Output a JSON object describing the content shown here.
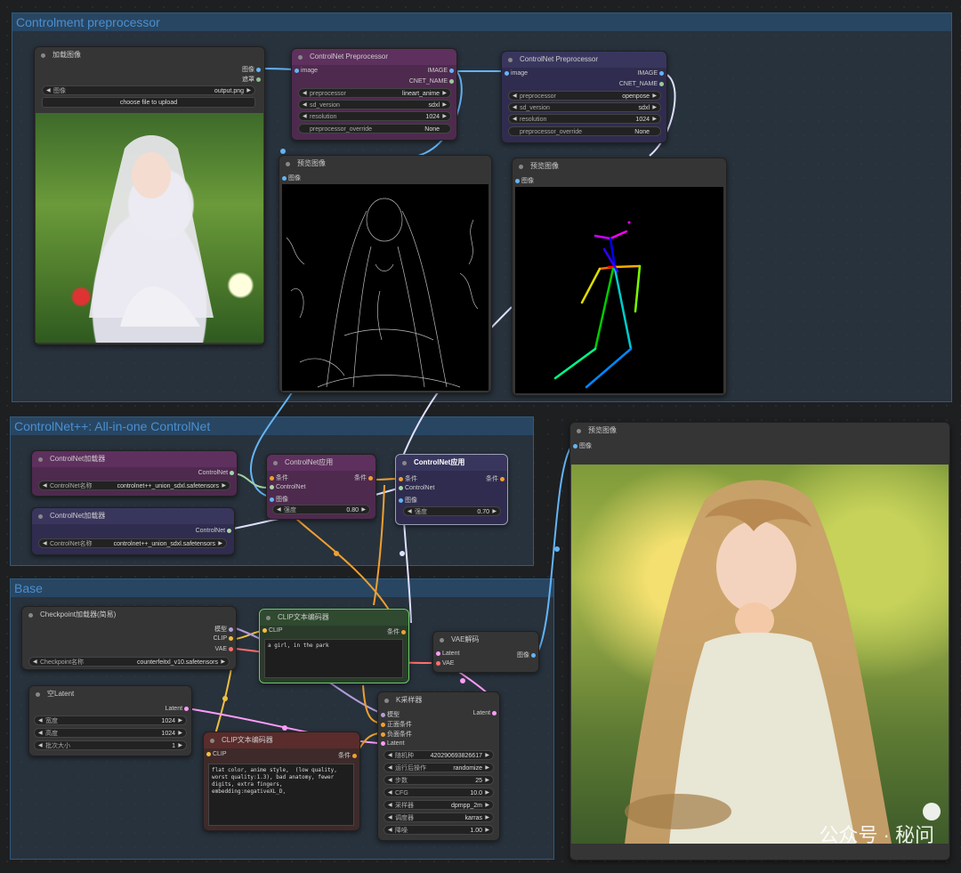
{
  "groups": {
    "preprocessor": "Controlment preprocessor",
    "controlnet_pp": "ControlNet++: All-in-one ControlNet",
    "base": "Base"
  },
  "load_image": {
    "title": "加载图像",
    "out_image": "图像",
    "out_mask": "遮罩",
    "image_label": "图像",
    "image_value": "output.png",
    "upload_button": "choose file to upload"
  },
  "preproc1": {
    "title": "ControlNet Preprocessor",
    "in_image": "image",
    "out_image": "IMAGE",
    "out_name": "CNET_NAME",
    "preprocessor_label": "preprocessor",
    "preprocessor_value": "lineart_anime",
    "sd_label": "sd_version",
    "sd_value": "sdxl",
    "res_label": "resolution",
    "res_value": "1024",
    "override_label": "preprocessor_override",
    "override_value": "None"
  },
  "preproc2": {
    "title": "ControlNet Preprocessor",
    "in_image": "image",
    "out_image": "IMAGE",
    "out_name": "CNET_NAME",
    "preprocessor_label": "preprocessor",
    "preprocessor_value": "openpose",
    "sd_label": "sd_version",
    "sd_value": "sdxl",
    "res_label": "resolution",
    "res_value": "1024",
    "override_label": "preprocessor_override",
    "override_value": "None"
  },
  "preview1": {
    "title": "预览图像",
    "in_image": "图像"
  },
  "preview2": {
    "title": "预览图像",
    "in_image": "图像"
  },
  "cn_loader1": {
    "title": "ControlNet加载器",
    "out": "ControlNet",
    "name_label": "ControlNet名称",
    "name_value": "controlnet++_union_sdxl.safetensors"
  },
  "cn_loader2": {
    "title": "ControlNet加载器",
    "out": "ControlNet",
    "name_label": "ControlNet名称",
    "name_value": "controlnet++_union_sdxl.safetensors"
  },
  "cn_apply1": {
    "title": "ControlNet应用",
    "in_cond": "条件",
    "in_cn": "ControlNet",
    "in_img": "图像",
    "out_cond": "条件",
    "strength_label": "强度",
    "strength_value": "0.80"
  },
  "cn_apply2": {
    "title": "ControlNet应用",
    "in_cond": "条件",
    "in_cn": "ControlNet",
    "in_img": "图像",
    "out_cond": "条件",
    "strength_label": "强度",
    "strength_value": "0.70"
  },
  "checkpoint": {
    "title": "Checkpoint加载器(简易)",
    "out_model": "模型",
    "out_clip": "CLIP",
    "out_vae": "VAE",
    "name_label": "Checkpoint名称",
    "name_value": "counterfeitxl_v10.safetensors"
  },
  "clip_pos": {
    "title": "CLIP文本编码器",
    "in_clip": "CLIP",
    "out_cond": "条件",
    "text": "a girl, in the park"
  },
  "clip_neg": {
    "title": "CLIP文本编码器",
    "in_clip": "CLIP",
    "out_cond": "条件",
    "text": "flat color, anime style,  (low quality, worst quality:1.3), bad anatomy, fewer digits, extra fingers, embedding:negativeXL_D,"
  },
  "vae_decode": {
    "title": "VAE解码",
    "in_latent": "Latent",
    "in_vae": "VAE",
    "out_image": "图像"
  },
  "empty_latent": {
    "title": "空Latent",
    "out": "Latent",
    "width_label": "宽度",
    "width_value": "1024",
    "height_label": "高度",
    "height_value": "1024",
    "batch_label": "批次大小",
    "batch_value": "1"
  },
  "ksampler": {
    "title": "K采样器",
    "in_model": "模型",
    "in_pos": "正面条件",
    "in_neg": "负面条件",
    "in_latent": "Latent",
    "out": "Latent",
    "seed_label": "随机种",
    "seed_value": "420290693826617",
    "control_label": "运行后操作",
    "control_value": "randomize",
    "steps_label": "步数",
    "steps_value": "25",
    "cfg_label": "CFG",
    "cfg_value": "10.0",
    "sampler_label": "采样器",
    "sampler_value": "dpmpp_2m",
    "scheduler_label": "调度器",
    "scheduler_value": "karras",
    "denoise_label": "降噪",
    "denoise_value": "1.00"
  },
  "preview_final": {
    "title": "预览图像",
    "in_image": "图像"
  },
  "watermark": "公众号 · 秘问",
  "colors": {
    "image_wire": "#64b5f6",
    "clip_wire": "#f0c040",
    "cond_wire": "#f0a030",
    "latent_wire": "#ff9cf9",
    "model_wire": "#b39ddb",
    "vae_wire": "#ff6e6e",
    "cn_wire": "#a5d6a7"
  }
}
